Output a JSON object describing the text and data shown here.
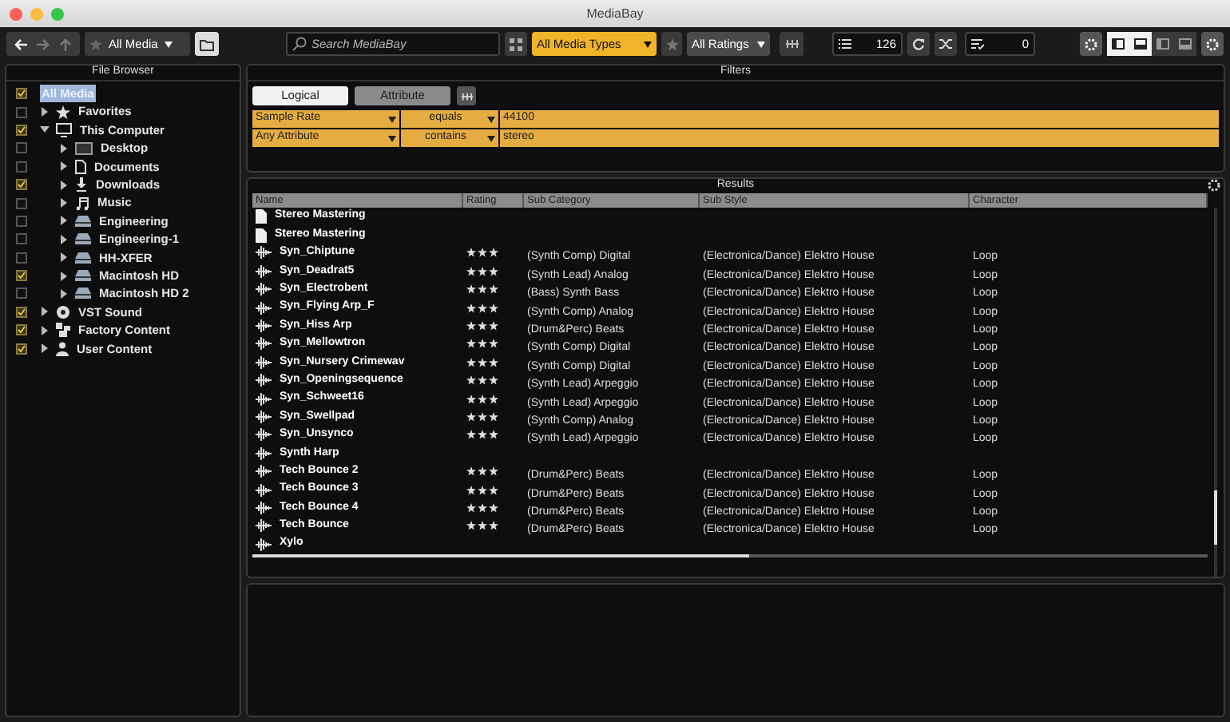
{
  "window": {
    "title": "MediaBay"
  },
  "toolbar": {
    "media_filter": "All Media",
    "search": {
      "placeholder": "Search MediaBay"
    },
    "media_types": "All Media Types",
    "ratings": "All Ratings",
    "result_count": "126",
    "selected_count": "0",
    "layout_toggles": [
      {
        "on": true
      },
      {
        "on": true
      },
      {
        "on": false
      },
      {
        "on": false
      }
    ]
  },
  "file_browser": {
    "title": "File Browser",
    "items": [
      {
        "label": "All Media",
        "kind": "root",
        "checked": true,
        "selected": true
      },
      {
        "label": "Favorites",
        "kind": "star",
        "checked": false,
        "expanded": false,
        "selected": false
      },
      {
        "label": "This Computer",
        "kind": "computer",
        "checked": true,
        "expanded": true,
        "selected": false,
        "children": [
          {
            "label": "Desktop",
            "kind": "desktop",
            "checked": false,
            "expanded": false,
            "selected": false
          },
          {
            "label": "Documents",
            "kind": "document",
            "checked": false,
            "expanded": false,
            "selected": false
          },
          {
            "label": "Downloads",
            "kind": "download",
            "checked": true,
            "expanded": false,
            "selected": false
          },
          {
            "label": "Music",
            "kind": "music",
            "checked": false,
            "expanded": false,
            "selected": false
          },
          {
            "label": "Engineering",
            "kind": "drive",
            "checked": false,
            "expanded": false,
            "selected": false
          },
          {
            "label": "Engineering-1",
            "kind": "drive",
            "checked": false,
            "expanded": false,
            "selected": false
          },
          {
            "label": "HH-XFER",
            "kind": "drive",
            "checked": false,
            "expanded": false,
            "selected": false
          },
          {
            "label": "Macintosh HD",
            "kind": "drive",
            "checked": true,
            "expanded": false,
            "selected": false
          },
          {
            "label": "Macintosh HD 2",
            "kind": "drive",
            "checked": false,
            "expanded": false,
            "selected": false
          }
        ]
      },
      {
        "label": "VST Sound",
        "kind": "disc",
        "checked": true,
        "expanded": false,
        "selected": false
      },
      {
        "label": "Factory Content",
        "kind": "blocks",
        "checked": true,
        "expanded": false,
        "selected": false
      },
      {
        "label": "User Content",
        "kind": "user",
        "checked": true,
        "expanded": false,
        "selected": false
      }
    ]
  },
  "filters": {
    "title": "Filters",
    "tabs": [
      {
        "label": "Logical",
        "selected": true
      },
      {
        "label": "Attribute",
        "selected": false
      }
    ],
    "conditions": [
      {
        "attribute": "Sample Rate",
        "operator": "equals",
        "value": "44100"
      },
      {
        "attribute": "Any Attribute",
        "operator": "contains",
        "value": "stereo"
      }
    ]
  },
  "results": {
    "title": "Results",
    "columns": [
      "Name",
      "Rating",
      "Sub Category",
      "Sub Style",
      "Character"
    ],
    "rows": [
      {
        "kind": "preset",
        "name": "Stereo Mastering"
      },
      {
        "kind": "preset",
        "name": "Stereo Mastering"
      },
      {
        "kind": "audio",
        "name": "Syn_Chiptune",
        "stars": 3,
        "sub_category": "(Synth Comp) Digital",
        "sub_style": "(Electronica/Dance) Elektro House",
        "character": "Loop"
      },
      {
        "kind": "audio",
        "name": "Syn_Deadrat5",
        "stars": 3,
        "sub_category": "(Synth Lead) Analog",
        "sub_style": "(Electronica/Dance) Elektro House",
        "character": "Loop"
      },
      {
        "kind": "audio",
        "name": "Syn_Electrobent",
        "stars": 3,
        "sub_category": "(Bass) Synth Bass",
        "sub_style": "(Electronica/Dance) Elektro House",
        "character": "Loop"
      },
      {
        "kind": "audio",
        "name": "Syn_Flying Arp_F",
        "stars": 3,
        "sub_category": "(Synth Comp) Analog",
        "sub_style": "(Electronica/Dance) Elektro House",
        "character": "Loop"
      },
      {
        "kind": "audio",
        "name": "Syn_Hiss Arp",
        "stars": 3,
        "sub_category": "(Drum&Perc) Beats",
        "sub_style": "(Electronica/Dance) Elektro House",
        "character": "Loop"
      },
      {
        "kind": "audio",
        "name": "Syn_Mellowtron",
        "stars": 3,
        "sub_category": "(Synth Comp) Digital",
        "sub_style": "(Electronica/Dance) Elektro House",
        "character": "Loop"
      },
      {
        "kind": "audio",
        "name": "Syn_Nursery Crimewav",
        "stars": 3,
        "sub_category": "(Synth Comp) Digital",
        "sub_style": "(Electronica/Dance) Elektro House",
        "character": "Loop"
      },
      {
        "kind": "audio",
        "name": "Syn_Openingsequence",
        "stars": 3,
        "sub_category": "(Synth Lead) Arpeggio",
        "sub_style": "(Electronica/Dance) Elektro House",
        "character": "Loop"
      },
      {
        "kind": "audio",
        "name": "Syn_Schweet16",
        "stars": 3,
        "sub_category": "(Synth Lead) Arpeggio",
        "sub_style": "(Electronica/Dance) Elektro House",
        "character": "Loop"
      },
      {
        "kind": "audio",
        "name": "Syn_Swellpad",
        "stars": 3,
        "sub_category": "(Synth Comp) Analog",
        "sub_style": "(Electronica/Dance) Elektro House",
        "character": "Loop"
      },
      {
        "kind": "audio",
        "name": "Syn_Unsynco",
        "stars": 3,
        "sub_category": "(Synth Lead) Arpeggio",
        "sub_style": "(Electronica/Dance) Elektro House",
        "character": "Loop"
      },
      {
        "kind": "audio",
        "name": "Synth Harp"
      },
      {
        "kind": "audio",
        "name": "Tech Bounce 2",
        "stars": 3,
        "sub_category": "(Drum&Perc) Beats",
        "sub_style": "(Electronica/Dance) Elektro House",
        "character": "Loop"
      },
      {
        "kind": "audio",
        "name": "Tech Bounce 3",
        "stars": 3,
        "sub_category": "(Drum&Perc) Beats",
        "sub_style": "(Electronica/Dance) Elektro House",
        "character": "Loop"
      },
      {
        "kind": "audio",
        "name": "Tech Bounce 4",
        "stars": 3,
        "sub_category": "(Drum&Perc) Beats",
        "sub_style": "(Electronica/Dance) Elektro House",
        "character": "Loop"
      },
      {
        "kind": "audio",
        "name": "Tech Bounce",
        "stars": 3,
        "sub_category": "(Drum&Perc) Beats",
        "sub_style": "(Electronica/Dance) Elektro House",
        "character": "Loop"
      },
      {
        "kind": "audio",
        "name": "Xylo"
      }
    ]
  }
}
